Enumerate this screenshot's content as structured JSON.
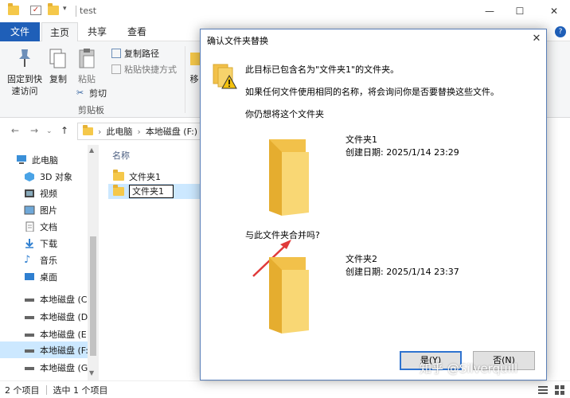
{
  "window": {
    "title": "test"
  },
  "ribbon_tabs": {
    "file": "文件",
    "home": "主页",
    "share": "共享",
    "view": "查看"
  },
  "ribbon": {
    "pin_quick_access": "固定到快\n速访问",
    "copy": "复制",
    "paste": "粘贴",
    "copy_path": "复制路径",
    "paste_shortcut": "粘贴快捷方式",
    "cut": "剪切",
    "clipboard_group": "剪贴板",
    "move_to": "移"
  },
  "address": {
    "segments": [
      "此电脑",
      "本地磁盘 (F:)"
    ],
    "separator": "›"
  },
  "sidebar": {
    "items": [
      {
        "label": "此电脑",
        "icon": "pc-icon"
      },
      {
        "label": "3D 对象",
        "icon": "cube-icon"
      },
      {
        "label": "视频",
        "icon": "video-icon"
      },
      {
        "label": "图片",
        "icon": "pictures-icon"
      },
      {
        "label": "文档",
        "icon": "document-icon"
      },
      {
        "label": "下载",
        "icon": "download-icon"
      },
      {
        "label": "音乐",
        "icon": "music-icon"
      },
      {
        "label": "桌面",
        "icon": "desktop-icon"
      },
      {
        "label": "本地磁盘 (C",
        "icon": "drive-icon"
      },
      {
        "label": "本地磁盘 (D",
        "icon": "drive-icon"
      },
      {
        "label": "本地磁盘 (E",
        "icon": "drive-icon"
      },
      {
        "label": "本地磁盘 (F:",
        "icon": "drive-icon"
      },
      {
        "label": "本地磁盘 (G",
        "icon": "drive-icon"
      }
    ]
  },
  "filelist": {
    "column_name": "名称",
    "rows": [
      {
        "name": "文件夹1"
      },
      {
        "name": "文件夹1"
      }
    ]
  },
  "status": {
    "count": "2 个项目",
    "selected": "选中 1 个项目"
  },
  "dialog": {
    "title": "确认文件夹替换",
    "line1": "此目标已包含名为\"文件夹1\"的文件夹。",
    "line2": "如果任何文件使用相同的名称，将会询问你是否要替换这些文件。",
    "line3": "你仍想将这个文件夹",
    "existing": {
      "name": "文件夹1",
      "date": "创建日期: 2025/1/14 23:29"
    },
    "question": "与此文件夹合并吗?",
    "incoming": {
      "name": "文件夹2",
      "date": "创建日期: 2025/1/14 23:37"
    },
    "yes": "是(Y)",
    "no": "否(N)"
  },
  "watermark": "知乎 @Silverquill",
  "colors": {
    "accent": "#1f5fb8",
    "folder": "#f5c84a",
    "selection": "#cce8ff",
    "arrow": "#e03a3a"
  }
}
